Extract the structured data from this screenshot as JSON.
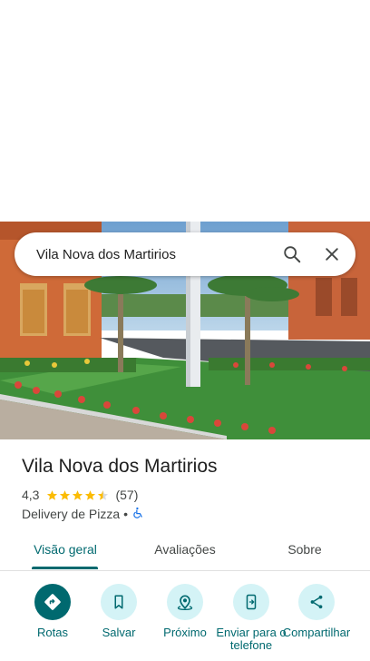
{
  "search": {
    "query": "Vila Nova dos Martirios"
  },
  "place": {
    "name": "Vila Nova dos Martirios",
    "rating": "4,3",
    "rating_value": 4.3,
    "review_count": "(57)",
    "category": "Delivery de Pizza",
    "separator": "•"
  },
  "tabs": [
    {
      "label": "Visão geral",
      "active": true
    },
    {
      "label": "Avaliações",
      "active": false
    },
    {
      "label": "Sobre",
      "active": false
    }
  ],
  "actions": [
    {
      "label": "Rotas",
      "icon": "directions-icon"
    },
    {
      "label": "Salvar",
      "icon": "bookmark-icon"
    },
    {
      "label": "Próximo",
      "icon": "nearby-icon"
    },
    {
      "label": "Enviar para o telefone",
      "icon": "send-to-phone-icon"
    },
    {
      "label": "Compartilhar",
      "icon": "share-icon"
    }
  ],
  "colors": {
    "accent": "#00696f",
    "accent_light": "#d4f3f6",
    "star": "#fbbc04",
    "accessibility": "#1a73e8"
  }
}
